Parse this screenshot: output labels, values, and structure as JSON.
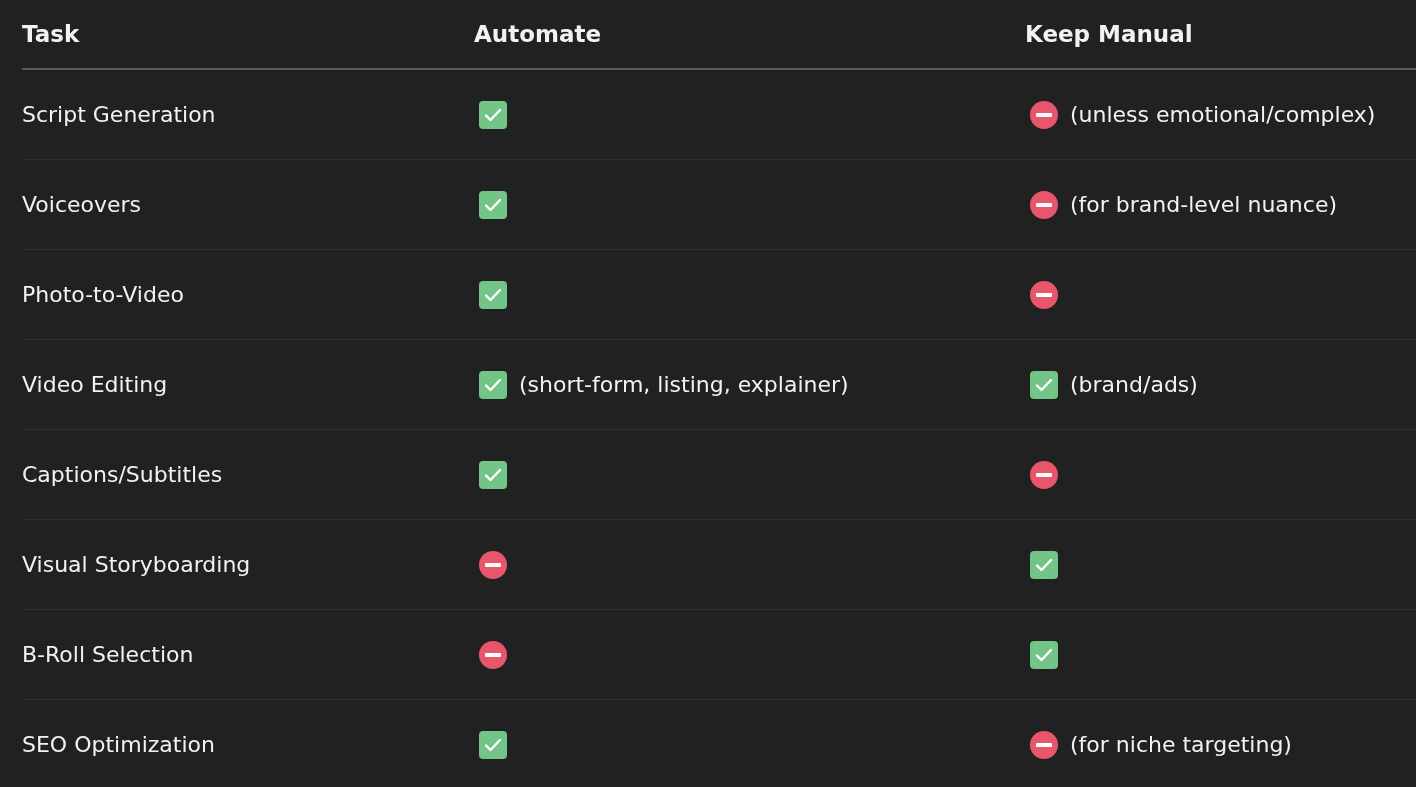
{
  "table": {
    "columns": [
      "Task",
      "Automate",
      "Keep Manual"
    ],
    "rows": [
      {
        "task": "Script Generation",
        "automate": {
          "kind": "check"
        },
        "manual": {
          "kind": "no_entry",
          "note": "(unless emotional/complex)"
        }
      },
      {
        "task": "Voiceovers",
        "automate": {
          "kind": "check"
        },
        "manual": {
          "kind": "no_entry",
          "note": "(for brand-level nuance)"
        }
      },
      {
        "task": "Photo-to-Video",
        "automate": {
          "kind": "check"
        },
        "manual": {
          "kind": "no_entry"
        }
      },
      {
        "task": "Video Editing",
        "automate": {
          "kind": "check",
          "note": "(short-form, listing, explainer)"
        },
        "manual": {
          "kind": "check",
          "note": "(brand/ads)"
        }
      },
      {
        "task": "Captions/Subtitles",
        "automate": {
          "kind": "check"
        },
        "manual": {
          "kind": "no_entry"
        }
      },
      {
        "task": "Visual Storyboarding",
        "automate": {
          "kind": "no_entry"
        },
        "manual": {
          "kind": "check"
        }
      },
      {
        "task": "B-Roll Selection",
        "automate": {
          "kind": "no_entry"
        },
        "manual": {
          "kind": "check"
        }
      },
      {
        "task": "SEO Optimization",
        "automate": {
          "kind": "check"
        },
        "manual": {
          "kind": "no_entry",
          "note": "(for niche targeting)"
        }
      }
    ]
  }
}
